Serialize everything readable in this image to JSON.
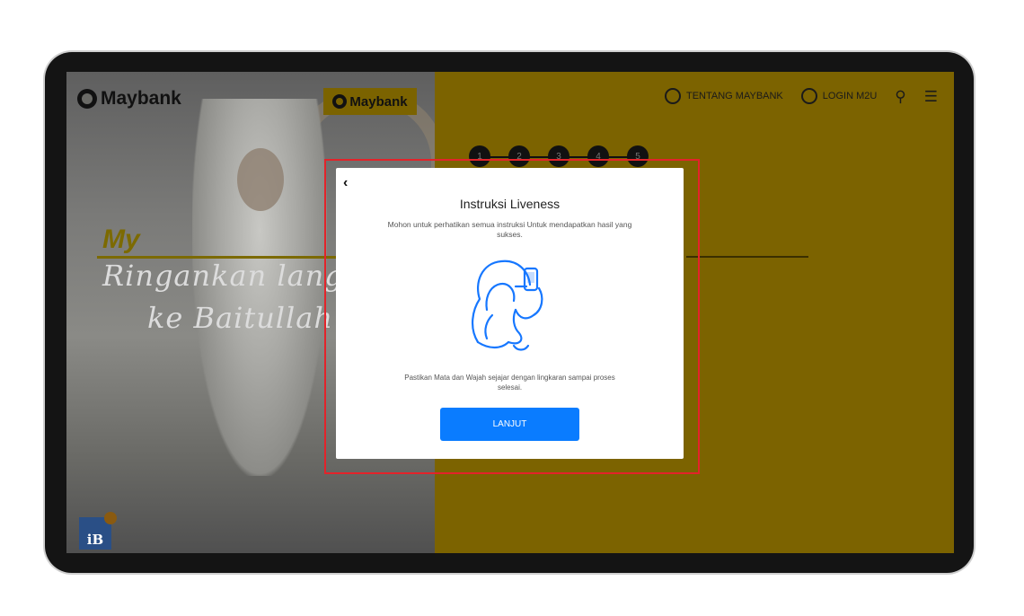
{
  "header": {
    "logo_text": "Maybank",
    "badge_logo_text": "Maybank",
    "nav": {
      "about_label": "TENTANG MAYBANK",
      "login_label": "LOGIN M2U"
    }
  },
  "hero": {
    "promo_word": "My",
    "promo_line1": "Ringankan langl",
    "promo_line2": "ke Baitullah",
    "ib_badge": "iB"
  },
  "steps": [
    "1",
    "2",
    "3",
    "4",
    "5"
  ],
  "modal": {
    "back_icon": "chevron-left-icon",
    "title": "Instruksi Liveness",
    "subtitle": "Mohon untuk perhatikan semua instruksi Untuk mendapatkan hasil yang sukses.",
    "illustration": "person-with-phone-selfie-icon",
    "note": "Pastikan Mata dan Wajah sejajar dengan lingkaran sampai proses selesai.",
    "button_label": "LANJUT"
  },
  "colors": {
    "gold_overlay": "#7c6300",
    "button_blue": "#0a7cff",
    "highlight_red": "#e3232a",
    "illustration_blue": "#1677ff"
  }
}
